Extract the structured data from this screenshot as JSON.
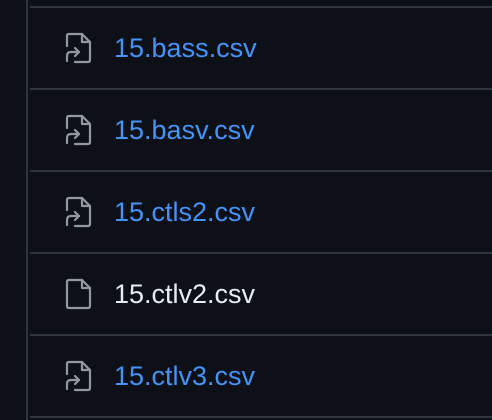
{
  "colors": {
    "background": "#0d1117",
    "border": "#30363d",
    "link": "#4493f8",
    "text": "#e6edf3",
    "icon": "#9198a1"
  },
  "files": [
    {
      "name": "15.bass.csv",
      "icon": "file-symlink-icon",
      "is_link": true
    },
    {
      "name": "15.basv.csv",
      "icon": "file-symlink-icon",
      "is_link": true
    },
    {
      "name": "15.ctls2.csv",
      "icon": "file-symlink-icon",
      "is_link": true
    },
    {
      "name": "15.ctlv2.csv",
      "icon": "file-icon",
      "is_link": false
    },
    {
      "name": "15.ctlv3.csv",
      "icon": "file-symlink-icon",
      "is_link": true
    }
  ]
}
